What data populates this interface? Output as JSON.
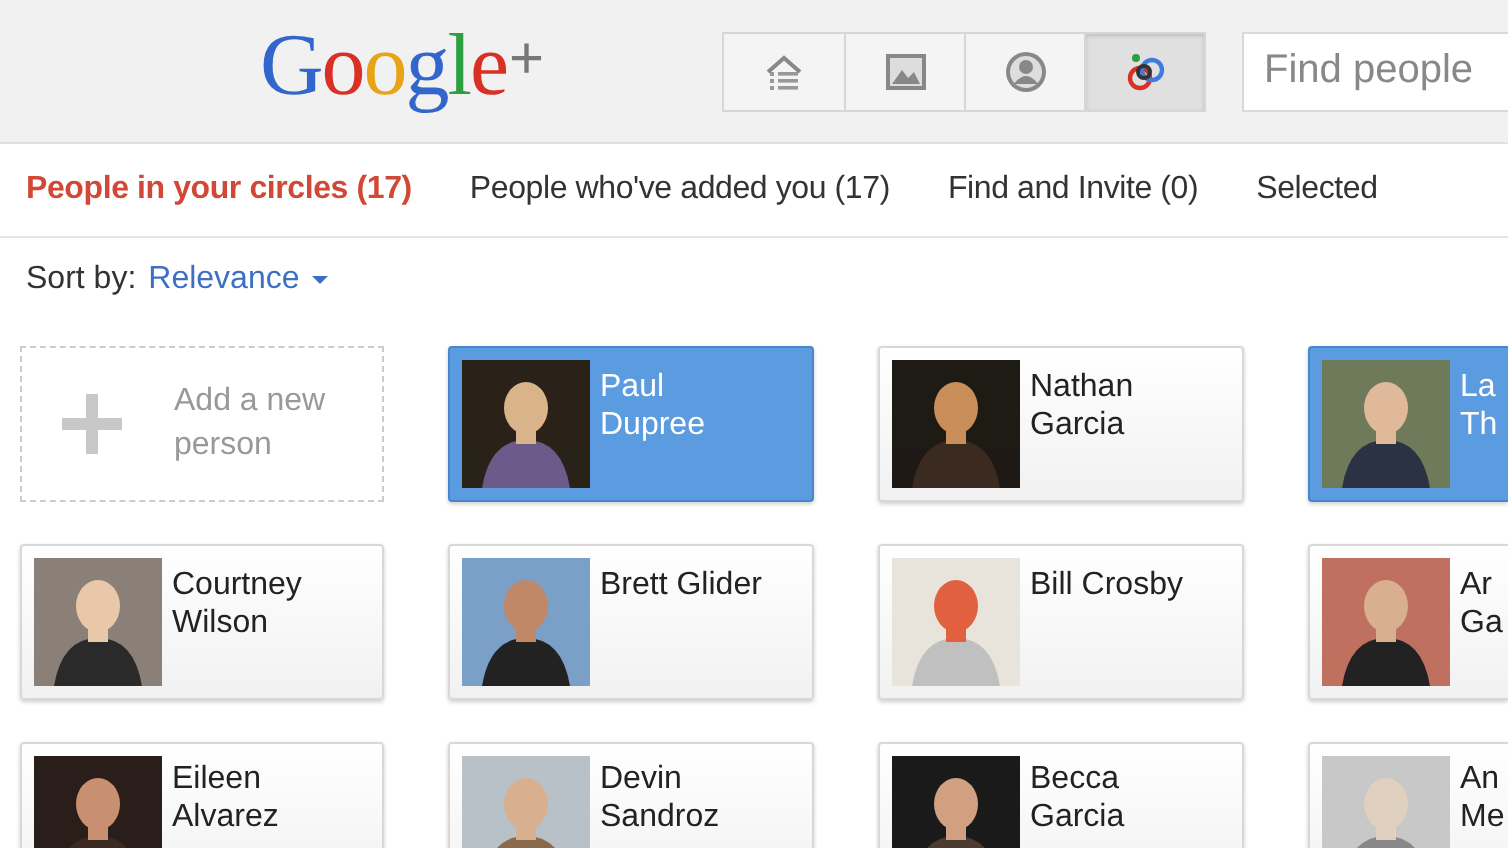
{
  "header": {
    "logo": "Google+",
    "nav_buttons": [
      {
        "kind": "home",
        "selected": false
      },
      {
        "kind": "photos",
        "selected": false
      },
      {
        "kind": "profile",
        "selected": false
      },
      {
        "kind": "circles",
        "selected": true
      }
    ],
    "search": {
      "placeholder": "Find people"
    }
  },
  "tabs": [
    {
      "label": "People in your circles (17)",
      "selected": true
    },
    {
      "label": "People who've added you (17)",
      "selected": false
    },
    {
      "label": "Find and Invite (0)",
      "selected": false
    },
    {
      "label": "Selected",
      "selected": false
    }
  ],
  "sort": {
    "label": "Sort by:",
    "value": "Relevance"
  },
  "add_card": {
    "label": "Add a new person"
  },
  "people": [
    {
      "lines": [
        "Paul",
        "Dupree"
      ],
      "selected": true
    },
    {
      "lines": [
        "Nathan",
        "Garcia"
      ],
      "selected": false
    },
    {
      "lines": [
        "La",
        "Th"
      ],
      "selected": true
    },
    {
      "lines": [
        "Courtney",
        "Wilson"
      ],
      "selected": false
    },
    {
      "lines": [
        "Brett Glider"
      ],
      "selected": false
    },
    {
      "lines": [
        "Bill Crosby"
      ],
      "selected": false
    },
    {
      "lines": [
        "Ar",
        "Ga"
      ],
      "selected": false
    },
    {
      "lines": [
        "Eileen",
        "Alvarez"
      ],
      "selected": false
    },
    {
      "lines": [
        "Devin",
        "Sandroz"
      ],
      "selected": false
    },
    {
      "lines": [
        "Becca",
        "Garcia"
      ],
      "selected": false
    },
    {
      "lines": [
        "An",
        "Me"
      ],
      "selected": false
    }
  ]
}
